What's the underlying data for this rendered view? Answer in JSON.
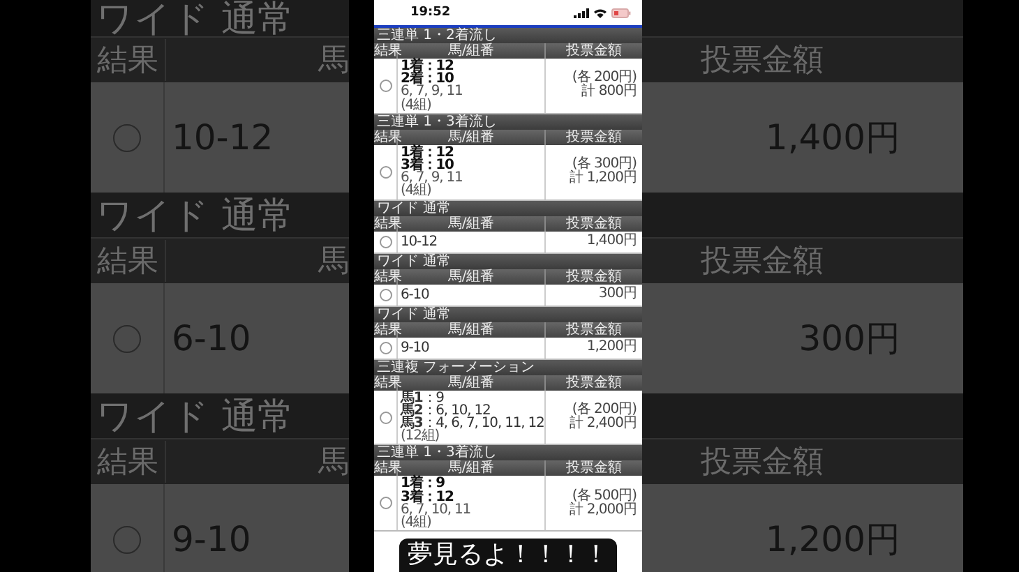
{
  "background": {
    "left_sections": [
      {
        "title": "ワイド 通常",
        "result_label": "結果",
        "horse_label": "馬",
        "combo": "10-12",
        "selected": false
      },
      {
        "title": "ワイド 通常",
        "result_label": "結果",
        "horse_label": "馬",
        "combo": "6-10",
        "selected": false
      },
      {
        "title": "ワイド 通常",
        "result_label": "結果",
        "horse_label": "馬",
        "combo": "9-10",
        "selected": false
      }
    ],
    "right_sections": [
      {
        "amount_label": "投票金額",
        "amount": "1,400円"
      },
      {
        "amount_label": "投票金額",
        "amount": "300円"
      },
      {
        "amount_label": "投票金額",
        "amount": "1,200円"
      }
    ]
  },
  "status_bar": {
    "time": "19:52"
  },
  "sections": [
    {
      "title": "三連単 1・2着流し",
      "columns": [
        "結果",
        "馬/組番",
        "投票金額"
      ],
      "selected": false,
      "lines": [
        {
          "kind": "leg",
          "text": "1着：12"
        },
        {
          "kind": "leg",
          "text": "2着：10"
        },
        {
          "kind": "note",
          "text": "6, 7, 9, 11"
        },
        {
          "kind": "note",
          "text": "(4組)"
        }
      ],
      "amount_lines": [
        "(各 200円)",
        "計 800円"
      ]
    },
    {
      "title": "三連単 1・3着流し",
      "columns": [
        "結果",
        "馬/組番",
        "投票金額"
      ],
      "selected": false,
      "lines": [
        {
          "kind": "leg",
          "text": "1着：12"
        },
        {
          "kind": "leg",
          "text": "3着：10"
        },
        {
          "kind": "note",
          "text": "6, 7, 9, 11"
        },
        {
          "kind": "note",
          "text": "(4組)"
        }
      ],
      "amount_lines": [
        "(各 300円)",
        "計 1,200円"
      ]
    },
    {
      "title": "ワイド 通常",
      "columns": [
        "結果",
        "馬/組番",
        "投票金額"
      ],
      "selected": false,
      "lines": [
        {
          "kind": "combo",
          "text": "10-12"
        }
      ],
      "amount_lines": [
        "1,400円"
      ]
    },
    {
      "title": "ワイド 通常",
      "columns": [
        "結果",
        "馬/組番",
        "投票金額"
      ],
      "selected": false,
      "lines": [
        {
          "kind": "combo",
          "text": "6-10"
        }
      ],
      "amount_lines": [
        "300円"
      ]
    },
    {
      "title": "ワイド 通常",
      "columns": [
        "結果",
        "馬/組番",
        "投票金額"
      ],
      "selected": false,
      "lines": [
        {
          "kind": "combo",
          "text": "9-10"
        }
      ],
      "amount_lines": [
        "1,200円"
      ]
    },
    {
      "title": "三連複 フォーメーション",
      "columns": [
        "結果",
        "馬/組番",
        "投票金額"
      ],
      "selected": false,
      "lines": [
        {
          "kind": "mixed",
          "text": "**馬1**：9"
        },
        {
          "kind": "mixed",
          "text": "**馬2**：6, 10, 12"
        },
        {
          "kind": "mixed",
          "text": "**馬3**：4, 6, 7, 10, 11, 12"
        },
        {
          "kind": "note",
          "text": "(12組)"
        }
      ],
      "amount_lines": [
        "(各 200円)",
        "計 2,400円"
      ]
    },
    {
      "title": "三連単 1・3着流し",
      "columns": [
        "結果",
        "馬/組番",
        "投票金額"
      ],
      "selected": false,
      "lines": [
        {
          "kind": "leg",
          "text": "1着：9"
        },
        {
          "kind": "leg",
          "text": "3着：12"
        },
        {
          "kind": "note",
          "text": "6, 7, 10, 11"
        },
        {
          "kind": "note",
          "text": "(4組)"
        }
      ],
      "amount_lines": [
        "(各 500円)",
        "計 2,000円"
      ]
    }
  ],
  "caption": "夢見るよ！！！！"
}
